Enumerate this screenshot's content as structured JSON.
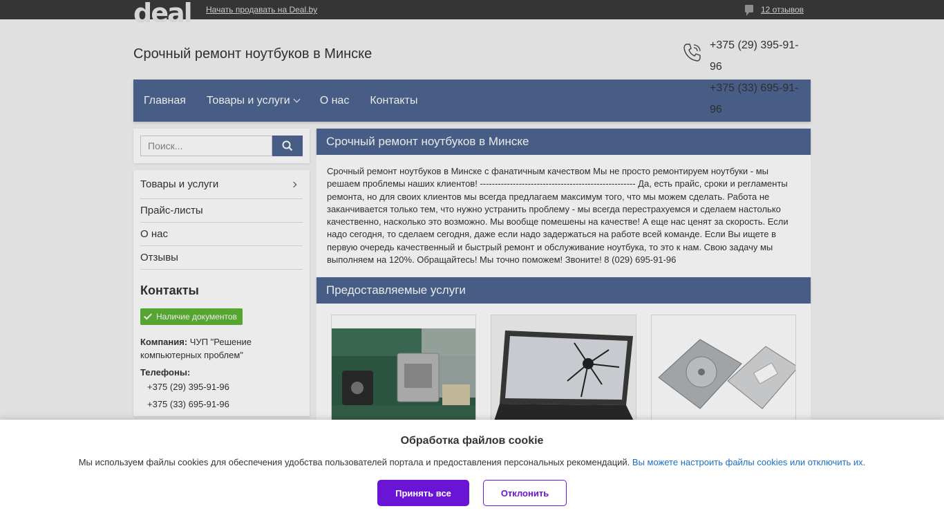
{
  "topbar": {
    "logo": "deal",
    "sell_link": "Начать продавать на Deal.by",
    "reviews_link": "12 отзывов"
  },
  "header": {
    "title": "Срочный ремонт ноутбуков в Минске",
    "phone1": "+375 (29) 395-91-96",
    "phone2": "+375 (33) 695-91-96"
  },
  "nav": {
    "items": [
      "Главная",
      "Товары и услуги",
      "О нас",
      "Контакты"
    ]
  },
  "search": {
    "placeholder": "Поиск..."
  },
  "side_menu": {
    "items": [
      "Товары и услуги",
      "Прайс-листы",
      "О нас",
      "Отзывы"
    ]
  },
  "contacts": {
    "heading": "Контакты",
    "badge": "Наличие документов",
    "company_label": "Компания:",
    "company_value": "ЧУП \"Решение компьютерных проблем\"",
    "phones_label": "Телефоны:",
    "phone1": "+375 (29) 395-91-96",
    "phone2": "+375 (33) 695-91-96"
  },
  "main": {
    "heading": "Срочный ремонт ноутбуков в Минске",
    "about_text": "Срочный ремонт ноутбуков в Минске с фанатичным качеством Мы не просто ремонтируем ноутбуки - мы решаем проблемы наших клиентов! ---------------------------------------------------- Да, есть прайс, сроки и регламенты ремонта, но для своих клиентов мы всегда предлагаем максимум того, что мы можем сделать. Работа не заканчивается только тем, что нужно устранить проблему - мы всегда перестрахуемся и сделаем настолько качественно, насколько это возможно. Мы вообще помешены на качестве! А еще нас ценят за скорость. Если надо сегодня, то сделаем сегодня, даже если надо задержаться на работе всей команде. Если Вы ищете в первую очередь качественный и быстрый ремонт и обслуживание ноутбука, то это к нам. Свою задачу мы выполняем на 120%. Обращайтесь! Мы точно поможем! Звоните! 8 (029) 695-91-96",
    "services_heading": "Предоставляемые услуги"
  },
  "cookie": {
    "title": "Обработка файлов cookie",
    "text": "Мы используем файлы cookies для обеспечения удобства пользователей портала и предоставления персональных рекомендаций.",
    "link": "Вы можете настроить файлы cookies или отключить их.",
    "accept": "Принять все",
    "decline": "Отклонить"
  },
  "colors": {
    "brand_blue": "#4e6591",
    "accept_purple": "#6a14d6",
    "badge_green": "#5fb336",
    "link_blue": "#1a6fc4"
  },
  "icons": [
    "phone-icon",
    "search-icon",
    "reviews-icon",
    "chevron-down-icon",
    "chevron-right-icon",
    "check-icon"
  ]
}
